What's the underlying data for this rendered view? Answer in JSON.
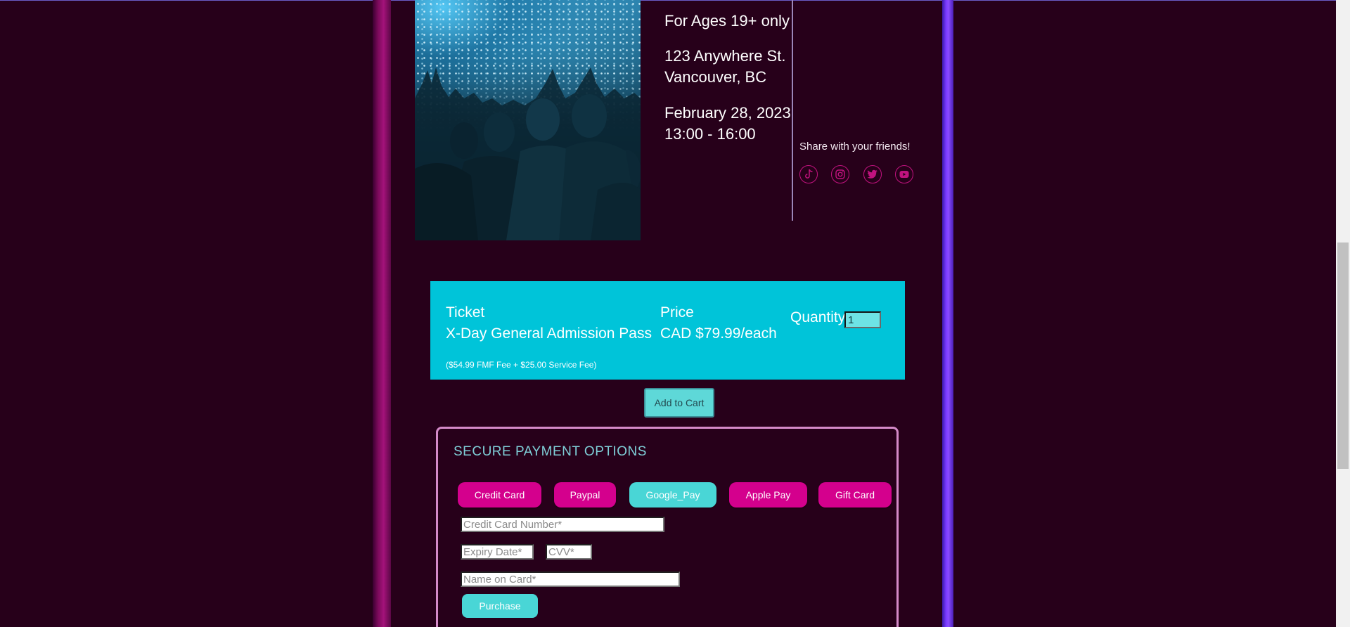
{
  "event": {
    "age_notice": "For Ages 19+ only",
    "address_line1": "123 Anywhere St.",
    "address_line2": "Vancouver, BC",
    "date": "February 28, 2023",
    "time": "13:00 - 16:00"
  },
  "share": {
    "label": "Share with your friends!",
    "icons": [
      "tiktok-icon",
      "instagram-icon",
      "twitter-icon",
      "youtube-icon"
    ]
  },
  "ticket": {
    "ticket_label": "Ticket",
    "ticket_name": "X-Day General Admission Pass",
    "fee_note": "($54.99 FMF Fee + $25.00 Service Fee)",
    "price_label": "Price",
    "price_value": "CAD $79.99/each",
    "quantity_label": "Quantity",
    "quantity_value": "1"
  },
  "cart": {
    "add_label": "Add to Cart"
  },
  "payment": {
    "title": "SECURE PAYMENT OPTIONS",
    "methods": [
      "Credit Card",
      "Paypal",
      "Google_Pay",
      "Apple Pay",
      "Gift Card"
    ],
    "selected": "Google_Pay",
    "fields": {
      "card_number_placeholder": "Credit Card Number*",
      "expiry_placeholder": "Expiry Date*",
      "cvv_placeholder": "CVV*",
      "name_placeholder": "Name on Card*"
    },
    "purchase_label": "Purchase"
  },
  "colors": {
    "background": "#27001a",
    "ticket_panel": "#00c4d9",
    "payment_button": "#d4008d",
    "payment_button_active": "#49d6d6",
    "payment_border": "#d48ac8",
    "left_accent": "#a3127a",
    "right_accent": "#7a3aff"
  }
}
